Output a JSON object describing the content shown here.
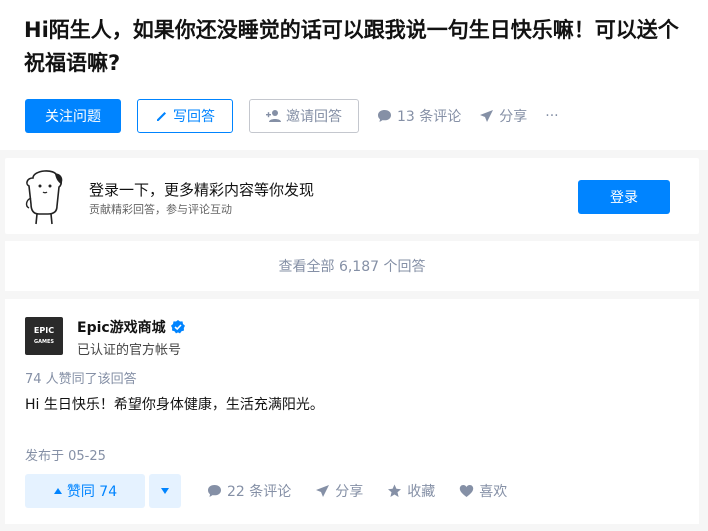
{
  "question": {
    "title": "Hi陌生人，如果你还没睡觉的话可以跟我说一句生日快乐嘛！可以送个祝福语嘛?",
    "follow_label": "关注问题",
    "write_label": "写回答",
    "invite_label": "邀请回答",
    "comments_label": "13 条评论",
    "share_label": "分享",
    "more_label": "···"
  },
  "login_prompt": {
    "title": "登录一下，更多精彩内容等你发现",
    "subtitle": "贡献精彩回答，参与评论互动",
    "button_label": "登录"
  },
  "view_all": {
    "label": "查看全部 6,187 个回答"
  },
  "answer": {
    "author_name": "Epic游戏商城",
    "author_badge": "已认证的官方帐号",
    "avatar_text_top": "EPIC",
    "avatar_text_bottom": "GAMES",
    "upvote_note": "74 人赞同了该回答",
    "content": "Hi 生日快乐！希望你身体健康，生活充满阳光。",
    "published": "发布于 05-25",
    "vote_label": "赞同 74",
    "comments_label": "22 条评论",
    "share_label": "分享",
    "collect_label": "收藏",
    "like_label": "喜欢"
  },
  "colors": {
    "brand_blue": "#0084ff",
    "muted_gray": "#8590a6",
    "vote_bg": "#e5f2ff"
  }
}
